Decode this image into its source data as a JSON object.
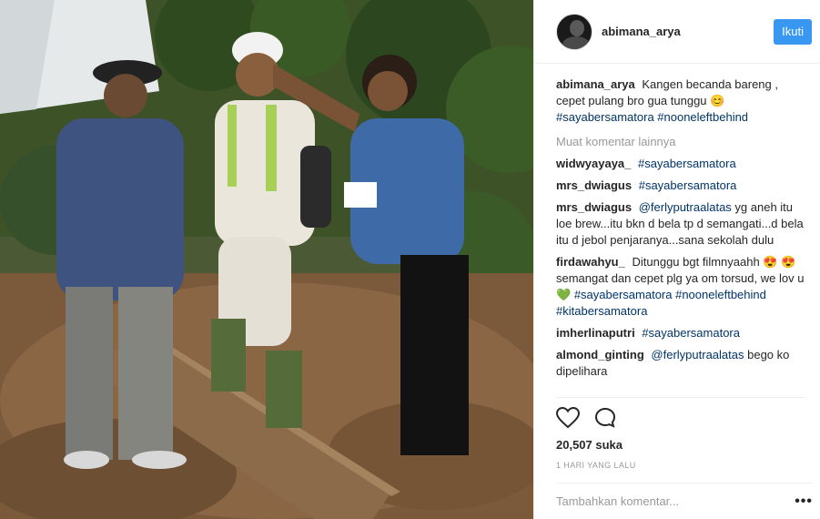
{
  "post": {
    "username": "abimana_arya",
    "follow_label": "Ikuti",
    "caption_user": "abimana_arya",
    "caption_text": "Kangen becanda bareng , cepet pulang bro gua tunggu 😊",
    "caption_tags": "#sayabersamatora #nooneleftbehind",
    "load_more": "Muat komentar lainnya",
    "likes": "20,507 suka",
    "time": "1 HARI YANG LALU",
    "add_comment_placeholder": "Tambahkan komentar...",
    "more_icon": "•••"
  },
  "comments": [
    {
      "user": "widwyayaya_",
      "text": "",
      "tags": "#sayabersamatora"
    },
    {
      "user": "mrs_dwiagus",
      "text": "",
      "tags": "#sayabersamatora"
    },
    {
      "user": "mrs_dwiagus",
      "mention": "@ferlyputraalatas",
      "text": "yg aneh itu loe brew...itu bkn d bela tp d semangati...d bela itu d jebol penjaranya...sana sekolah dulu",
      "tags": ""
    },
    {
      "user": "firdawahyu_",
      "text": "Ditunggu bgt filmnyaahh 😍 😍 semangat dan cepet plg ya om torsud, we lov u 💚",
      "tags": "#sayabersamatora #nooneleftbehind #kitabersamatora"
    },
    {
      "user": "imherlinaputri",
      "text": "",
      "tags": "#sayabersamatora"
    },
    {
      "user": "almond_ginting",
      "mention": "@ferlyputraalatas",
      "text": "bego ko dipelihara",
      "tags": ""
    }
  ],
  "colors": {
    "accent": "#3897f0",
    "hashtag": "#003569",
    "muted": "#999999"
  },
  "icons": {
    "like": "heart-icon",
    "comment": "comment-bubble-icon",
    "options": "more-options-icon"
  }
}
